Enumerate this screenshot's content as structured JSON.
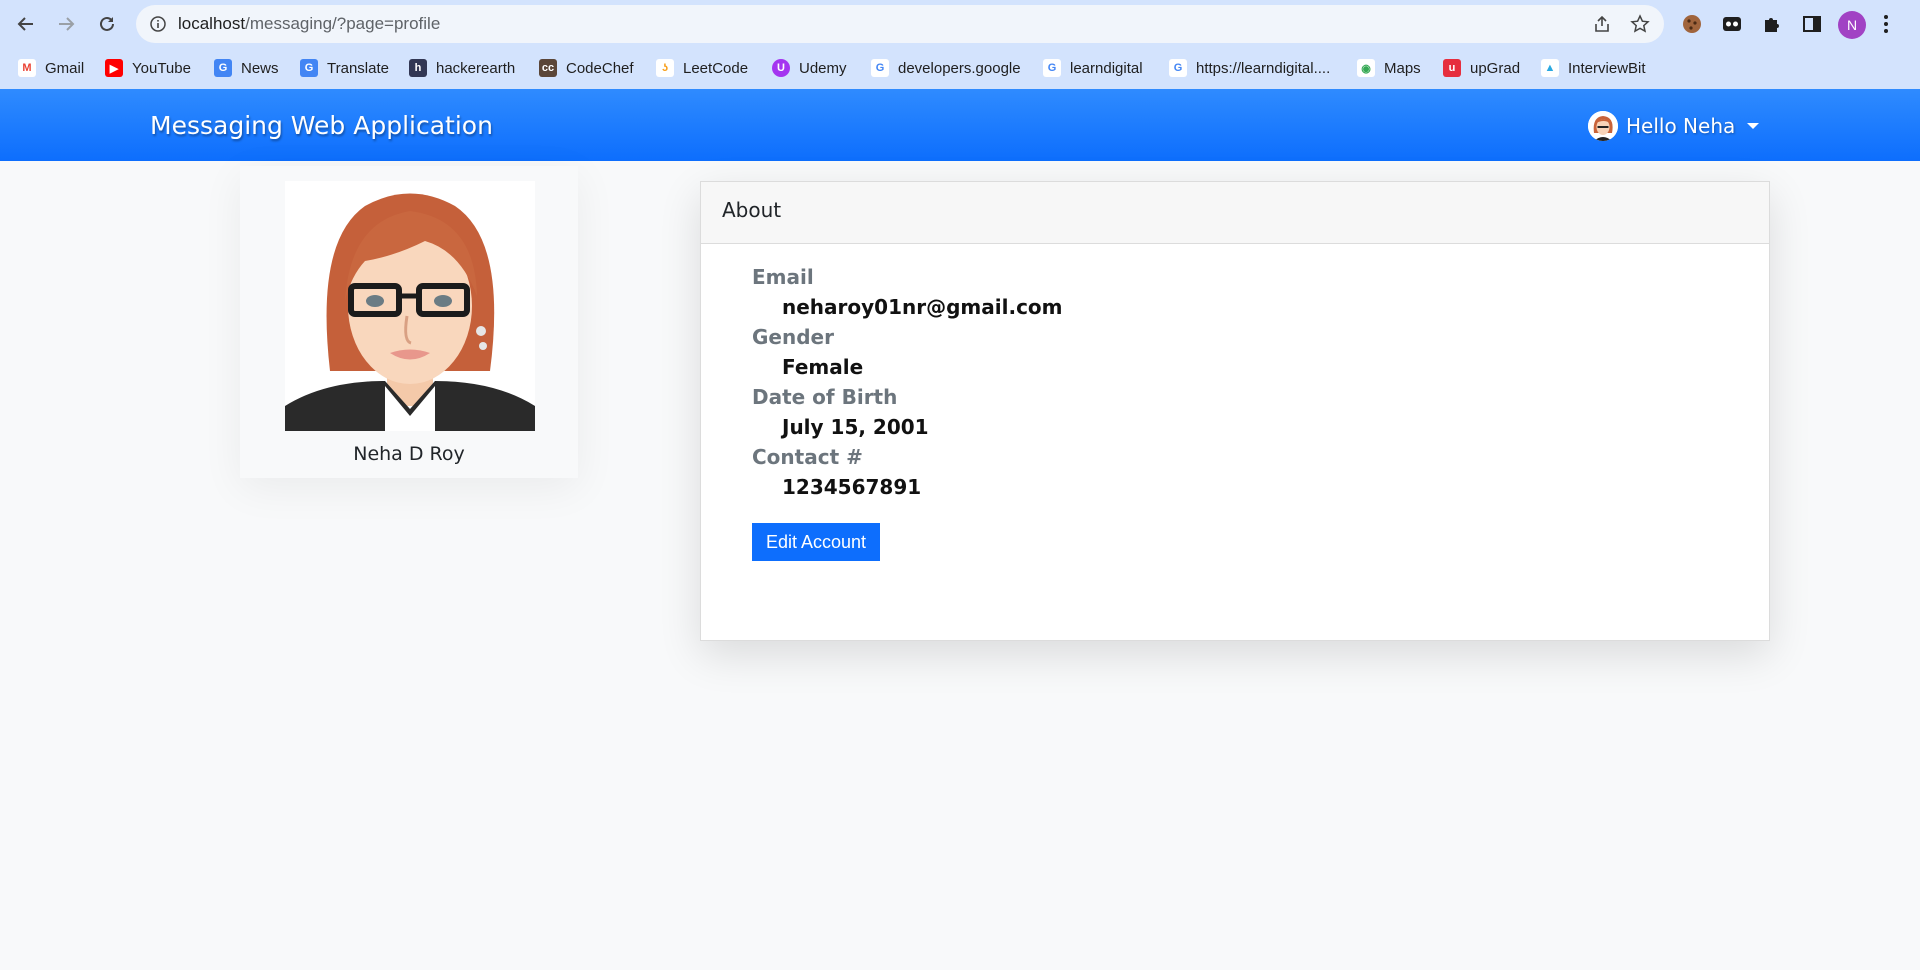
{
  "browser": {
    "url_host": "localhost",
    "url_path": "/messaging/?page=profile",
    "profile_initial": "N",
    "bookmarks": [
      {
        "label": "Gmail",
        "icon": "gmail-icon"
      },
      {
        "label": "YouTube",
        "icon": "youtube-icon"
      },
      {
        "label": "News",
        "icon": "news-icon"
      },
      {
        "label": "Translate",
        "icon": "translate-icon"
      },
      {
        "label": "hackerearth",
        "icon": "hackerearth-icon"
      },
      {
        "label": "CodeChef",
        "icon": "codechef-icon"
      },
      {
        "label": "LeetCode",
        "icon": "leetcode-icon"
      },
      {
        "label": "Udemy",
        "icon": "udemy-icon"
      },
      {
        "label": "developers.google",
        "icon": "google-icon"
      },
      {
        "label": "learndigital",
        "icon": "google-icon"
      },
      {
        "label": "https://learndigital....",
        "icon": "google-icon"
      },
      {
        "label": "Maps",
        "icon": "maps-icon"
      },
      {
        "label": "upGrad",
        "icon": "upgrad-icon"
      },
      {
        "label": "InterviewBit",
        "icon": "interviewbit-icon"
      }
    ]
  },
  "navbar": {
    "brand": "Messaging Web Application",
    "greeting": "Hello Neha"
  },
  "profile": {
    "name": "Neha D Roy"
  },
  "about": {
    "title": "About",
    "email_label": "Email",
    "email": "neharoy01nr@gmail.com",
    "gender_label": "Gender",
    "gender": "Female",
    "dob_label": "Date of Birth",
    "dob": "July 15, 2001",
    "contact_label": "Contact #",
    "contact": "1234567891",
    "edit_button": "Edit Account"
  },
  "colors": {
    "navbar": "#0d6efd",
    "button": "#0d6efd",
    "chrome": "#d3e3fd"
  }
}
